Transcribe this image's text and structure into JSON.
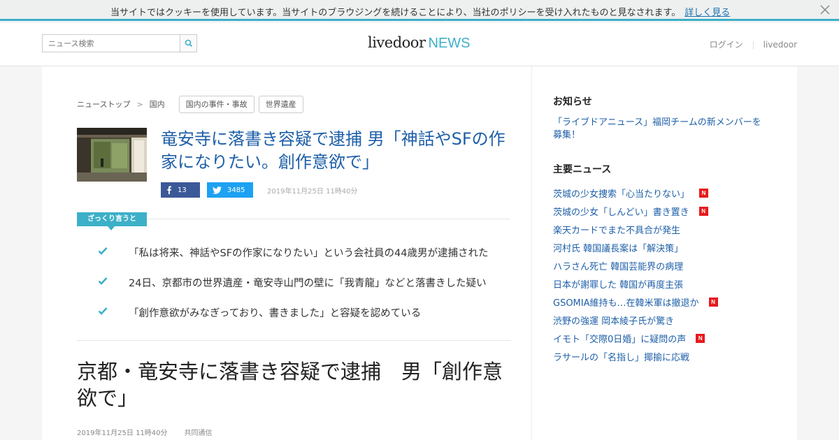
{
  "cookie": {
    "message": "当サイトではクッキーを使用しています。当サイトのブラウジングを続けることにより、当社のポリシーを受け入れたものと見なされます。",
    "link_label": "詳しく見る"
  },
  "header": {
    "search_placeholder": "ニュース検索",
    "logo_main": "livedoor",
    "logo_news": "NEWS",
    "login_label": "ログイン",
    "livedoor_label": "livedoor"
  },
  "breadcrumb": {
    "top": "ニューストップ",
    "category": "国内",
    "tags": [
      "国内の事件・事故",
      "世界遺産"
    ]
  },
  "article": {
    "headline": "竜安寺に落書き容疑で逮捕 男「神話やSFの作家になりたい。創作意欲で」",
    "facebook_count": "13",
    "twitter_count": "3485",
    "date": "2019年11月25日 11時40分",
    "summary_label": "ざっくり言うと",
    "points": [
      "「私は将来、神話やSFの作家になりたい」という会社員の44歳男が逮捕された",
      "24日、京都市の世界遺産・竜安寺山門の壁に「我青龍」などと落書きした疑い",
      "「創作意欲がみなぎっており、書きました」と容疑を認めている"
    ],
    "title": "京都・竜安寺に落書き容疑で逮捕　男「創作意欲で」",
    "meta_date": "2019年11月25日 11時40分",
    "source": "共同通信"
  },
  "sidebar": {
    "notice_heading": "お知らせ",
    "notice_link": "「ライブドアニュース」福岡チームの新メンバーを募集！",
    "news_heading": "主要ニュース",
    "news": [
      {
        "title": "茨城の少女捜索「心当たりない」",
        "new": true
      },
      {
        "title": "茨城の少女「しんどい」書き置き",
        "new": true
      },
      {
        "title": "楽天カードでまた不具合が発生",
        "new": false
      },
      {
        "title": "河村氏 韓国議長案は「解決策」",
        "new": false
      },
      {
        "title": "ハラさん死亡 韓国芸能界の病理",
        "new": false
      },
      {
        "title": "日本が謝罪した 韓国が再度主張",
        "new": false
      },
      {
        "title": "GSOMIA維持も…在韓米軍は撤退か",
        "new": true
      },
      {
        "title": "渋野の強運 岡本綾子氏が驚き",
        "new": false
      },
      {
        "title": "イモト「交際0日婚」に疑問の声",
        "new": true
      },
      {
        "title": "ラサールの「名指し」揶揄に応戦",
        "new": false
      }
    ],
    "new_badge": "N"
  },
  "colors": {
    "accent": "#3cb0c8",
    "link": "#1e5fa8",
    "facebook": "#3b5998",
    "twitter": "#1da1f2",
    "new_badge": "#e8191c"
  }
}
